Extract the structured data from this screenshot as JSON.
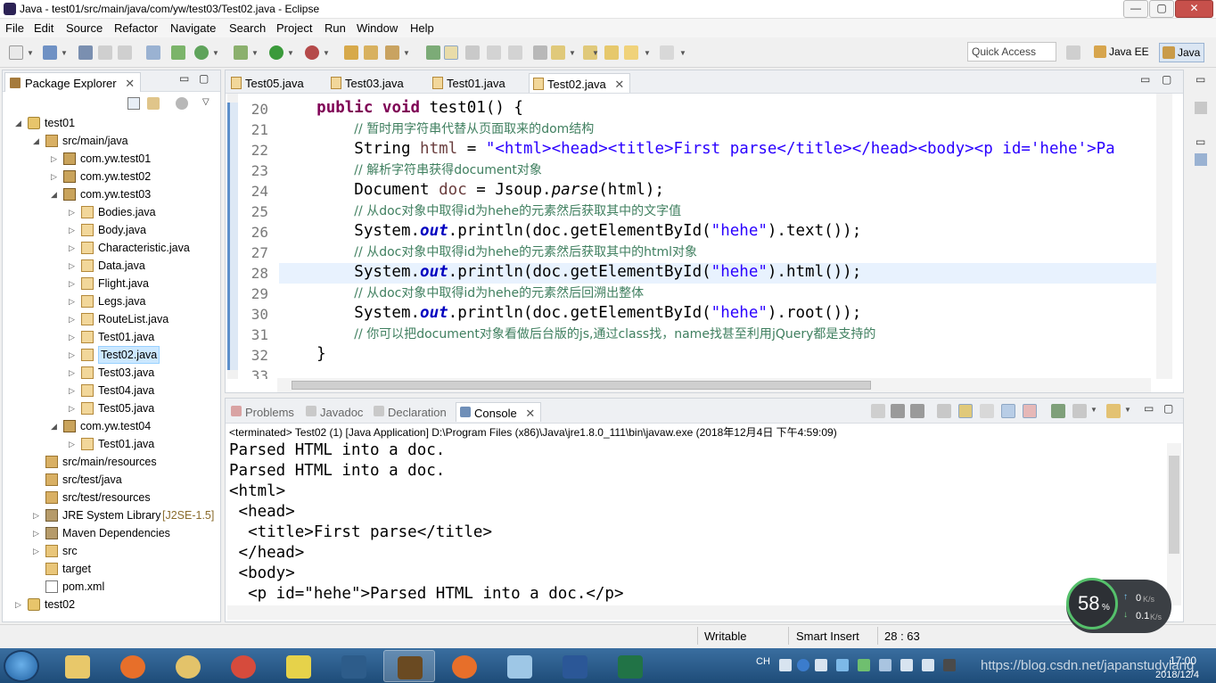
{
  "window": {
    "title": "Java - test01/src/main/java/com/yw/test03/Test02.java - Eclipse",
    "minimize": "—",
    "maximize": "▢",
    "close": "✕"
  },
  "menu": [
    "File",
    "Edit",
    "Source",
    "Refactor",
    "Navigate",
    "Search",
    "Project",
    "Run",
    "Window",
    "Help"
  ],
  "toolbar": {
    "quick_access": "Quick Access",
    "perspective_javaee": "Java EE",
    "perspective_java": "Java"
  },
  "package_explorer": {
    "title": "Package Explorer",
    "tree": [
      {
        "label": "test01",
        "kind": "project",
        "level": 0,
        "twisty": "open"
      },
      {
        "label": "src/main/java",
        "kind": "srcfolder",
        "level": 1,
        "twisty": "open"
      },
      {
        "label": "com.yw.test01",
        "kind": "package",
        "level": 2,
        "twisty": "closed"
      },
      {
        "label": "com.yw.test02",
        "kind": "package",
        "level": 2,
        "twisty": "closed"
      },
      {
        "label": "com.yw.test03",
        "kind": "package",
        "level": 2,
        "twisty": "open"
      },
      {
        "label": "Bodies.java",
        "kind": "java",
        "level": 3,
        "twisty": "closed"
      },
      {
        "label": "Body.java",
        "kind": "java",
        "level": 3,
        "twisty": "closed"
      },
      {
        "label": "Characteristic.java",
        "kind": "java",
        "level": 3,
        "twisty": "closed"
      },
      {
        "label": "Data.java",
        "kind": "java",
        "level": 3,
        "twisty": "closed"
      },
      {
        "label": "Flight.java",
        "kind": "java",
        "level": 3,
        "twisty": "closed"
      },
      {
        "label": "Legs.java",
        "kind": "java",
        "level": 3,
        "twisty": "closed"
      },
      {
        "label": "RouteList.java",
        "kind": "java",
        "level": 3,
        "twisty": "closed"
      },
      {
        "label": "Test01.java",
        "kind": "java",
        "level": 3,
        "twisty": "closed"
      },
      {
        "label": "Test02.java",
        "kind": "java",
        "level": 3,
        "twisty": "closed",
        "selected": true
      },
      {
        "label": "Test03.java",
        "kind": "java",
        "level": 3,
        "twisty": "closed"
      },
      {
        "label": "Test04.java",
        "kind": "java",
        "level": 3,
        "twisty": "closed"
      },
      {
        "label": "Test05.java",
        "kind": "java",
        "level": 3,
        "twisty": "closed"
      },
      {
        "label": "com.yw.test04",
        "kind": "package",
        "level": 2,
        "twisty": "open"
      },
      {
        "label": "Test01.java",
        "kind": "java",
        "level": 3,
        "twisty": "closed"
      },
      {
        "label": "src/main/resources",
        "kind": "srcfolder",
        "level": 1,
        "twisty": ""
      },
      {
        "label": "src/test/java",
        "kind": "srcfolder",
        "level": 1,
        "twisty": ""
      },
      {
        "label": "src/test/resources",
        "kind": "srcfolder",
        "level": 1,
        "twisty": ""
      },
      {
        "label": "JRE System Library",
        "suffix": " [J2SE-1.5]",
        "kind": "library",
        "level": 1,
        "twisty": "closed"
      },
      {
        "label": "Maven Dependencies",
        "kind": "library",
        "level": 1,
        "twisty": "closed"
      },
      {
        "label": "src",
        "kind": "folder",
        "level": 1,
        "twisty": "closed"
      },
      {
        "label": "target",
        "kind": "folder",
        "level": 1,
        "twisty": ""
      },
      {
        "label": "pom.xml",
        "kind": "xml",
        "level": 1,
        "twisty": ""
      },
      {
        "label": "test02",
        "kind": "project",
        "level": 0,
        "twisty": "closed"
      }
    ]
  },
  "editor": {
    "tabs": [
      {
        "label": "Test05.java",
        "active": false
      },
      {
        "label": "Test03.java",
        "active": false
      },
      {
        "label": "Test01.java",
        "active": false
      },
      {
        "label": "Test02.java",
        "active": true,
        "close": "✕"
      }
    ],
    "line_numbers": [
      "20",
      "21",
      "22",
      "23",
      "24",
      "25",
      "26",
      "27",
      "28",
      "29",
      "30",
      "31",
      "32",
      "33"
    ],
    "current_line": "28",
    "lines": [
      [
        {
          "t": "    "
        },
        {
          "t": "public",
          "c": "kw"
        },
        {
          "t": " "
        },
        {
          "t": "void",
          "c": "kw"
        },
        {
          "t": " test01() {"
        }
      ],
      [
        {
          "t": "        "
        },
        {
          "t": "// ",
          "c": "cm"
        },
        {
          "t": "暂时用字符串代替从页面取来的",
          "c": "cm"
        },
        {
          "t": "dom",
          "c": "cm cmb"
        },
        {
          "t": "结构",
          "c": "cm"
        }
      ],
      [
        {
          "t": "        String "
        },
        {
          "t": "html",
          "c": "var"
        },
        {
          "t": " = "
        },
        {
          "t": "\"<html><head><title>First parse</title></head><body><p id='hehe'>Pa",
          "c": "str"
        }
      ],
      [
        {
          "t": "        "
        },
        {
          "t": "// ",
          "c": "cm"
        },
        {
          "t": "解析字符串获得",
          "c": "cm"
        },
        {
          "t": "document",
          "c": "cm cmb"
        },
        {
          "t": "对象",
          "c": "cm"
        }
      ],
      [
        {
          "t": "        Document "
        },
        {
          "t": "doc",
          "c": "var"
        },
        {
          "t": " = Jsoup."
        },
        {
          "t": "parse",
          "c": "it"
        },
        {
          "t": "(html);"
        }
      ],
      [
        {
          "t": "        "
        },
        {
          "t": "// ",
          "c": "cm"
        },
        {
          "t": "从",
          "c": "cm"
        },
        {
          "t": "doc",
          "c": "cm cmb"
        },
        {
          "t": "对象中取得",
          "c": "cm"
        },
        {
          "t": "id",
          "c": "cm cmb"
        },
        {
          "t": "为",
          "c": "cm"
        },
        {
          "t": "hehe",
          "c": "cm cmb"
        },
        {
          "t": "的元素然后获取其中的文字值",
          "c": "cm"
        }
      ],
      [
        {
          "t": "        System."
        },
        {
          "t": "out",
          "c": "fld"
        },
        {
          "t": ".println(doc.getElementById("
        },
        {
          "t": "\"hehe\"",
          "c": "str"
        },
        {
          "t": ").text());"
        }
      ],
      [
        {
          "t": "        "
        },
        {
          "t": "// ",
          "c": "cm"
        },
        {
          "t": "从",
          "c": "cm"
        },
        {
          "t": "doc",
          "c": "cm cmb"
        },
        {
          "t": "对象中取得",
          "c": "cm"
        },
        {
          "t": "id",
          "c": "cm cmb"
        },
        {
          "t": "为",
          "c": "cm"
        },
        {
          "t": "hehe",
          "c": "cm cmb"
        },
        {
          "t": "的元素然后获取其中的",
          "c": "cm"
        },
        {
          "t": "html",
          "c": "cm cmb"
        },
        {
          "t": "对象",
          "c": "cm"
        }
      ],
      [
        {
          "t": "        System."
        },
        {
          "t": "out",
          "c": "fld"
        },
        {
          "t": ".println(doc.getElementById("
        },
        {
          "t": "\"hehe\"",
          "c": "str"
        },
        {
          "t": ").html());"
        }
      ],
      [
        {
          "t": "        "
        },
        {
          "t": "// ",
          "c": "cm"
        },
        {
          "t": "从",
          "c": "cm"
        },
        {
          "t": "doc",
          "c": "cm cmb"
        },
        {
          "t": "对象中取得",
          "c": "cm"
        },
        {
          "t": "id",
          "c": "cm cmb"
        },
        {
          "t": "为",
          "c": "cm"
        },
        {
          "t": "hehe",
          "c": "cm cmb"
        },
        {
          "t": "的元素然后回溯出整体",
          "c": "cm"
        }
      ],
      [
        {
          "t": "        System."
        },
        {
          "t": "out",
          "c": "fld"
        },
        {
          "t": ".println(doc.getElementById("
        },
        {
          "t": "\"hehe\"",
          "c": "str"
        },
        {
          "t": ").root());"
        }
      ],
      [
        {
          "t": "        "
        },
        {
          "t": "// ",
          "c": "cm"
        },
        {
          "t": "你可以把",
          "c": "cm"
        },
        {
          "t": "document",
          "c": "cm cmb"
        },
        {
          "t": "对象看做后台版的",
          "c": "cm"
        },
        {
          "t": "js",
          "c": "cm cmb"
        },
        {
          "t": ",通过",
          "c": "cm"
        },
        {
          "t": "class",
          "c": "cm cmb"
        },
        {
          "t": "找，",
          "c": "cm"
        },
        {
          "t": "name",
          "c": "cm cmb"
        },
        {
          "t": "找甚至利用",
          "c": "cm"
        },
        {
          "t": "jQuery",
          "c": "cm cmb"
        },
        {
          "t": "都是支持的",
          "c": "cm"
        }
      ],
      [
        {
          "t": "    }"
        }
      ]
    ]
  },
  "console": {
    "tabs": [
      {
        "label": "Problems",
        "active": false
      },
      {
        "label": "Javadoc",
        "active": false
      },
      {
        "label": "Declaration",
        "active": false
      },
      {
        "label": "Console",
        "active": true,
        "close": "✕"
      }
    ],
    "status": "<terminated> Test02 (1) [Java Application] D:\\Program Files (x86)\\Java\\jre1.8.0_111\\bin\\javaw.exe (2018年12月4日 下午4:59:09)",
    "output": [
      "Parsed HTML into a doc.",
      "Parsed HTML into a doc.",
      "<html>",
      " <head>",
      "  <title>First parse</title>",
      " </head>",
      " <body>",
      "  <p id=\"hehe\">Parsed HTML into a doc.</p>"
    ]
  },
  "statusbar": {
    "writable": "Writable",
    "insert_mode": "Smart Insert",
    "position": "28 : 63"
  },
  "net_widget": {
    "percent": "58",
    "percent_sign": "%",
    "up_value": "0",
    "up_unit": "K/s",
    "down_value": "0.1",
    "down_unit": "K/s"
  },
  "taskbar": {
    "tray_lang": "CH",
    "time": "17:00",
    "date": "2018/12/4",
    "watermark": "https://blog.csdn.net/japanstudylang"
  }
}
